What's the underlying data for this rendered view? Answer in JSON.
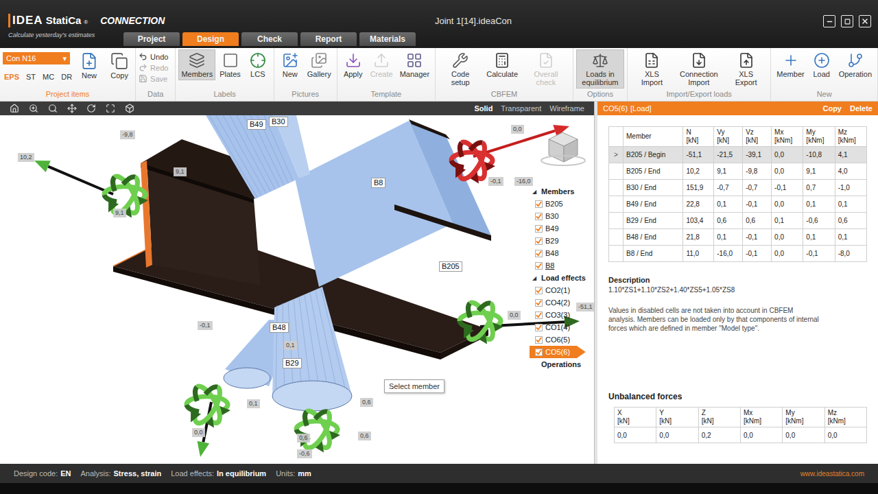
{
  "window": {
    "title": "Joint 1[14].ideaCon"
  },
  "logo": {
    "brand": "IDEA",
    "name": "StatiCa",
    "mark": "®",
    "product": "CONNECTION",
    "tagline": "Calculate yesterday's estimates"
  },
  "tabs": [
    {
      "label": "Project",
      "selected": false
    },
    {
      "label": "Design",
      "selected": true
    },
    {
      "label": "Check",
      "selected": false
    },
    {
      "label": "Report",
      "selected": false
    },
    {
      "label": "Materials",
      "selected": false
    }
  ],
  "ribbon": {
    "project_items": {
      "label": "Project items",
      "connection": "Con N16",
      "caret": "▾",
      "item_tabs": [
        {
          "label": "EPS",
          "selected": true
        },
        {
          "label": "ST",
          "selected": false
        },
        {
          "label": "MC",
          "selected": false
        },
        {
          "label": "DR",
          "selected": false
        }
      ],
      "buttons": [
        {
          "label": "New",
          "disabled": false,
          "selected": false
        },
        {
          "label": "Copy",
          "disabled": false,
          "selected": false
        }
      ]
    },
    "groups": [
      {
        "label": "Data",
        "buttons": [
          {
            "label": "Undo",
            "kind": "small",
            "disabled": false,
            "selected": false
          },
          {
            "label": "Redo",
            "kind": "small",
            "disabled": true,
            "selected": false
          },
          {
            "label": "Save",
            "kind": "small",
            "disabled": true,
            "selected": false
          }
        ]
      },
      {
        "label": "Labels",
        "buttons": [
          {
            "label": "Members",
            "kind": "large",
            "disabled": false,
            "selected": true
          },
          {
            "label": "Plates",
            "kind": "large",
            "disabled": false,
            "selected": false
          },
          {
            "label": "LCS",
            "kind": "large",
            "disabled": false,
            "selected": false
          }
        ]
      },
      {
        "label": "Pictures",
        "buttons": [
          {
            "label": "New",
            "kind": "large",
            "disabled": false,
            "selected": false
          },
          {
            "label": "Gallery",
            "kind": "large",
            "disabled": false,
            "selected": false
          }
        ]
      },
      {
        "label": "Template",
        "buttons": [
          {
            "label": "Apply",
            "kind": "large",
            "disabled": false,
            "selected": false
          },
          {
            "label": "Create",
            "kind": "large",
            "disabled": true,
            "selected": false
          },
          {
            "label": "Manager",
            "kind": "large",
            "disabled": false,
            "selected": false
          }
        ]
      },
      {
        "label": "CBFEM",
        "buttons": [
          {
            "label": "Code setup",
            "kind": "large",
            "disabled": false,
            "selected": false
          },
          {
            "label": "Calculate",
            "kind": "large",
            "disabled": false,
            "selected": false
          },
          {
            "label": "Overall check",
            "kind": "large",
            "disabled": true,
            "selected": false
          }
        ]
      },
      {
        "label": "Options",
        "buttons": [
          {
            "label": "Loads in equilibrium",
            "kind": "large",
            "disabled": false,
            "selected": true
          }
        ]
      },
      {
        "label": "Import/Export loads",
        "buttons": [
          {
            "label": "XLS Import",
            "kind": "large",
            "disabled": false,
            "selected": false
          },
          {
            "label": "Connection Import",
            "kind": "large",
            "disabled": false,
            "selected": false
          },
          {
            "label": "XLS Export",
            "kind": "large",
            "disabled": false,
            "selected": false
          }
        ]
      },
      {
        "label": "New",
        "buttons": [
          {
            "label": "Member",
            "kind": "large",
            "disabled": false,
            "selected": false
          },
          {
            "label": "Load",
            "kind": "large",
            "disabled": false,
            "selected": false
          },
          {
            "label": "Operation",
            "kind": "large",
            "disabled": false,
            "selected": false
          }
        ]
      }
    ]
  },
  "view_modes": [
    {
      "label": "Solid",
      "selected": true
    },
    {
      "label": "Transparent",
      "selected": false
    },
    {
      "label": "Wireframe",
      "selected": false
    }
  ],
  "scene": {
    "member_labels": [
      "B30",
      "B49",
      "B8",
      "B205",
      "B48",
      "B29"
    ],
    "value_labels": [
      "-9,8",
      "10,2",
      "9,1",
      "9,1",
      "0,0",
      "-0,1",
      "-16,0",
      "0,0",
      "-51,1",
      "-0,1",
      "0,1",
      "0,6",
      "0,6",
      "0,0",
      "0,1",
      "0,6",
      "-0,6"
    ],
    "tooltip": "Select member"
  },
  "tree": {
    "sections": [
      {
        "label": "Members",
        "toggle": "◢",
        "items": [
          {
            "label": "B205",
            "checked": true,
            "selected": false,
            "hovered": false
          },
          {
            "label": "B30",
            "checked": true,
            "selected": false,
            "hovered": false
          },
          {
            "label": "B49",
            "checked": true,
            "selected": false,
            "hovered": false
          },
          {
            "label": "B29",
            "checked": true,
            "selected": false,
            "hovered": false
          },
          {
            "label": "B48",
            "checked": true,
            "selected": false,
            "hovered": false
          },
          {
            "label": "B8",
            "checked": true,
            "selected": false,
            "hovered": true
          }
        ]
      },
      {
        "label": "Load effects",
        "toggle": "◢",
        "items": [
          {
            "label": "CO2(1)",
            "checked": true,
            "selected": false,
            "hovered": false
          },
          {
            "label": "CO4(2)",
            "checked": true,
            "selected": false,
            "hovered": false
          },
          {
            "label": "CO3(3)",
            "checked": true,
            "selected": false,
            "hovered": false
          },
          {
            "label": "CO1(4)",
            "checked": true,
            "selected": false,
            "hovered": false
          },
          {
            "label": "CO6(5)",
            "checked": true,
            "selected": false,
            "hovered": false
          },
          {
            "label": "CO5(6)",
            "checked": true,
            "selected": true,
            "hovered": false
          }
        ]
      },
      {
        "label": "Operations",
        "toggle": "",
        "items": []
      }
    ]
  },
  "panel": {
    "title": "CO5(6)",
    "subtitle": "[Load]",
    "actions": [
      "Copy",
      "Delete"
    ],
    "forces_table": {
      "marker": ">",
      "columns": [
        {
          "name": "Member"
        },
        {
          "name": "N",
          "unit": "[kN]"
        },
        {
          "name": "Vy",
          "unit": "[kN]"
        },
        {
          "name": "Vz",
          "unit": "[kN]"
        },
        {
          "name": "Mx",
          "unit": "[kNm]"
        },
        {
          "name": "My",
          "unit": "[kNm]"
        },
        {
          "name": "Mz",
          "unit": "[kNm]"
        }
      ],
      "rows": [
        {
          "selected": true,
          "cells": [
            "B205 / Begin",
            "-51,1",
            "-21,5",
            "-39,1",
            "0,0",
            "-10,8",
            "4,1"
          ]
        },
        {
          "selected": false,
          "cells": [
            "B205 / End",
            "10,2",
            "9,1",
            "-9,8",
            "0,0",
            "9,1",
            "4,0"
          ]
        },
        {
          "selected": false,
          "cells": [
            "B30 / End",
            "151,9",
            "-0,7",
            "-0,7",
            "-0,1",
            "0,7",
            "-1,0"
          ]
        },
        {
          "selected": false,
          "cells": [
            "B49 / End",
            "22,8",
            "0,1",
            "-0,1",
            "0,0",
            "0,1",
            "0,1"
          ]
        },
        {
          "selected": false,
          "cells": [
            "B29 / End",
            "103,4",
            "0,6",
            "0,6",
            "0,1",
            "-0,6",
            "0,6"
          ]
        },
        {
          "selected": false,
          "cells": [
            "B48 / End",
            "21,8",
            "0,1",
            "-0,1",
            "0,0",
            "0,1",
            "0,1"
          ]
        },
        {
          "selected": false,
          "cells": [
            "B8 / End",
            "11,0",
            "-16,0",
            "-0,1",
            "0,0",
            "-0,1",
            "-8,0"
          ]
        }
      ]
    },
    "description": {
      "label": "Description",
      "value": "1.10*ZS1+1.10*ZS2+1.40*ZS5+1.05*ZS8"
    },
    "note": "Values in disabled cells are not taken into account in CBFEM analysis. Members can be loaded only by that components of internal forces which are defined in member \"Model type\".",
    "unbalanced": {
      "title": "Unbalanced forces",
      "columns": [
        {
          "name": "X",
          "unit": "[kN]"
        },
        {
          "name": "Y",
          "unit": "[kN]"
        },
        {
          "name": "Z",
          "unit": "[kN]"
        },
        {
          "name": "Mx",
          "unit": "[kNm]"
        },
        {
          "name": "My",
          "unit": "[kNm]"
        },
        {
          "name": "Mz",
          "unit": "[kNm]"
        }
      ],
      "values": [
        "0,0",
        "0,0",
        "0,2",
        "0,0",
        "0,0",
        "0,0"
      ]
    }
  },
  "status_bar": {
    "items": [
      {
        "label": "Design code:",
        "value": "EN"
      },
      {
        "label": "Analysis:",
        "value": "Stress, strain"
      },
      {
        "label": "Load effects:",
        "value": "In equilibrium"
      },
      {
        "label": "Units:",
        "value": "mm"
      }
    ],
    "link": "www.ideastatica.com"
  }
}
